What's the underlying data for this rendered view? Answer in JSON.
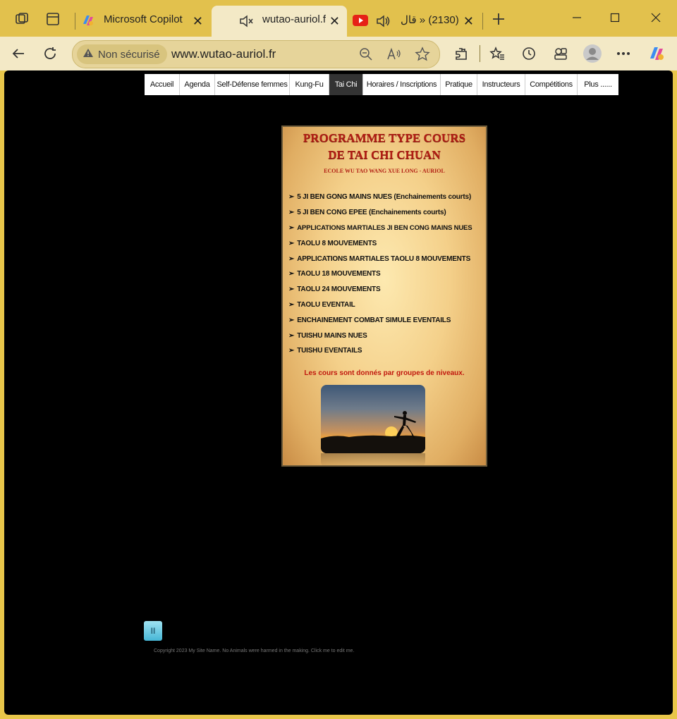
{
  "browser": {
    "tabs": [
      {
        "title": "Microsoft Copilot",
        "icon": "copilot-icon"
      },
      {
        "title": "wutao-auriol.fr",
        "icon": "muted-speaker-icon",
        "active": true
      },
      {
        "title": "(2130) « قال",
        "icon": "youtube-icon"
      }
    ],
    "address": {
      "security_label": "Non sécurisé",
      "url": "www.wutao-auriol.fr"
    }
  },
  "page": {
    "nav": [
      "Accueil",
      "Agenda",
      "Self-Défense femmes",
      "Kung-Fu",
      "Tai Chi",
      "Horaires / Inscriptions",
      "Pratique",
      "Instructeurs",
      "Compétitions",
      "Plus ......"
    ],
    "nav_active": "Tai Chi",
    "poster": {
      "title_line1": "PROGRAMME TYPE COURS",
      "title_line2": "DE TAI CHI CHUAN",
      "subtitle": "ECOLE WU TAO WANG XUE LONG - AURIOL",
      "items": [
        "5 JI BEN GONG MAINS NUES (Enchainements courts)",
        "5 JI BEN CONG EPEE (Enchainements courts)",
        "APPLICATIONS MARTIALES JI BEN CONG MAINS NUES",
        "TAOLU 8 MOUVEMENTS",
        "APPLICATIONS MARTIALES TAOLU 8 MOUVEMENTS",
        "TAOLU 18 MOUVEMENTS",
        "TAOLU 24 MOUVEMENTS",
        "TAOLU EVENTAIL",
        "ENCHAINEMENT COMBAT SIMULE EVENTAILS",
        "TUISHU MAINS NUES",
        "TUISHU EVENTAILS"
      ],
      "note": "Les cours sont donnés par groupes de niveaux."
    },
    "pause_label": "II",
    "copyright": "Copyright 2023 My Site Name. No Animals were harmed in the making. Click me to edit me."
  },
  "colors": {
    "titlebar": "#e2c14d",
    "toolbar": "#f3e9c6",
    "poster_red": "#b11e14"
  }
}
